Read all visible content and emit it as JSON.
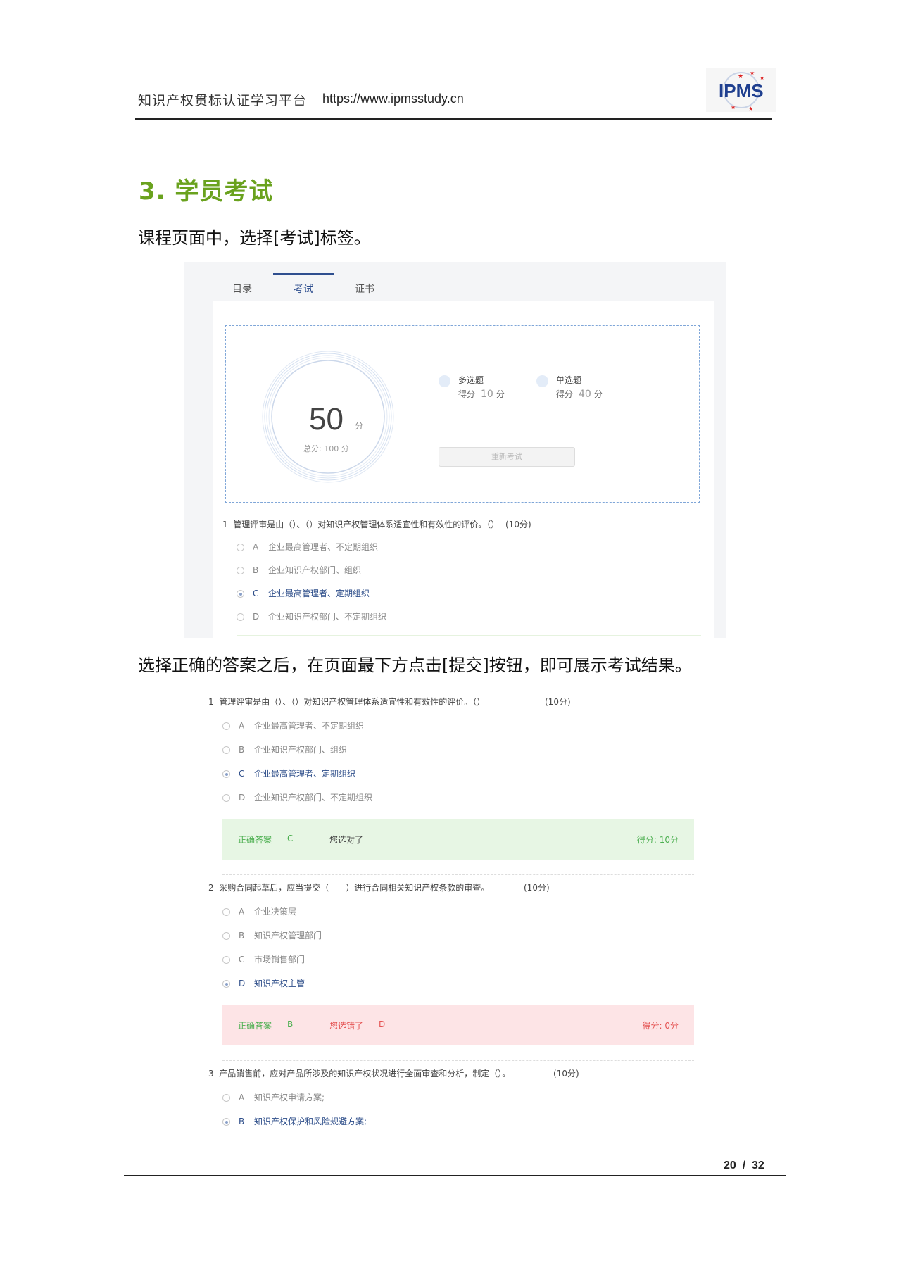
{
  "header": {
    "title": "知识产权贯标认证学习平台",
    "url": "https://www.ipmsstudy.cn",
    "logo_text": "IPMS"
  },
  "section": {
    "heading": "3. 学员考试",
    "para1": "课程页面中，选择[考试]标签。",
    "para2": "选择正确的答案之后，在页面最下方点击[提交]按钮，即可展示考试结果。"
  },
  "shot1": {
    "tabs": [
      "目录",
      "考试",
      "证书"
    ],
    "active_tab": "考试",
    "score": "50",
    "score_unit": "分",
    "total": "总分: 100 分",
    "categories": [
      {
        "title": "多选题",
        "label": "得分",
        "value": "10",
        "unit": "分"
      },
      {
        "title": "单选题",
        "label": "得分",
        "value": "40",
        "unit": "分"
      }
    ],
    "retake": "重新考试",
    "question": {
      "num": "1",
      "text": "管理评审是由（）、（）对知识产权管理体系适宜性和有效性的评价。（）",
      "points": "(10分)",
      "options": [
        {
          "letter": "A",
          "text": "企业最高管理者、不定期组织",
          "selected": false
        },
        {
          "letter": "B",
          "text": "企业知识产权部门、组织",
          "selected": false
        },
        {
          "letter": "C",
          "text": "企业最高管理者、定期组织",
          "selected": true
        },
        {
          "letter": "D",
          "text": "企业知识产权部门、不定期组织",
          "selected": false
        }
      ]
    }
  },
  "shot2": {
    "questions": [
      {
        "num": "1",
        "text": "管理评审是由（）、（）对知识产权管理体系适宜性和有效性的评价。（）",
        "points": "(10分)",
        "options": [
          {
            "letter": "A",
            "text": "企业最高管理者、不定期组织",
            "selected": false
          },
          {
            "letter": "B",
            "text": "企业知识产权部门、组织",
            "selected": false
          },
          {
            "letter": "C",
            "text": "企业最高管理者、定期组织",
            "selected": true
          },
          {
            "letter": "D",
            "text": "企业知识产权部门、不定期组织",
            "selected": false
          }
        ],
        "result": {
          "correct_label": "正确答案",
          "correct": "C",
          "verdict": "您选对了",
          "picked": "",
          "score": "得分: 10分",
          "status": "correct"
        }
      },
      {
        "num": "2",
        "text": "采购合同起草后，应当提交（　　）进行合同相关知识产权条款的审查。",
        "points": "(10分)",
        "options": [
          {
            "letter": "A",
            "text": "企业决策层",
            "selected": false
          },
          {
            "letter": "B",
            "text": "知识产权管理部门",
            "selected": false
          },
          {
            "letter": "C",
            "text": "市场销售部门",
            "selected": false
          },
          {
            "letter": "D",
            "text": "知识产权主管",
            "selected": true
          }
        ],
        "result": {
          "correct_label": "正确答案",
          "correct": "B",
          "verdict": "您选错了",
          "picked": "D",
          "score": "得分: 0分",
          "status": "wrong"
        }
      },
      {
        "num": "3",
        "text": "产品销售前，应对产品所涉及的知识产权状况进行全面审查和分析，制定（）。",
        "points": "(10分)",
        "options": [
          {
            "letter": "A",
            "text": "知识产权申请方案;",
            "selected": false
          },
          {
            "letter": "B",
            "text": "知识产权保护和风险规避方案;",
            "selected": true
          }
        ]
      }
    ]
  },
  "footer": {
    "page": "20",
    "sep": "/",
    "total": "32"
  },
  "colors": {
    "heading_green": "#6aa21e",
    "tab_accent": "#2f4f8f",
    "correct_bg": "#e7f6e4",
    "wrong_bg": "#fde4e6",
    "correct_text": "#4caf50",
    "wrong_text": "#e55353"
  }
}
